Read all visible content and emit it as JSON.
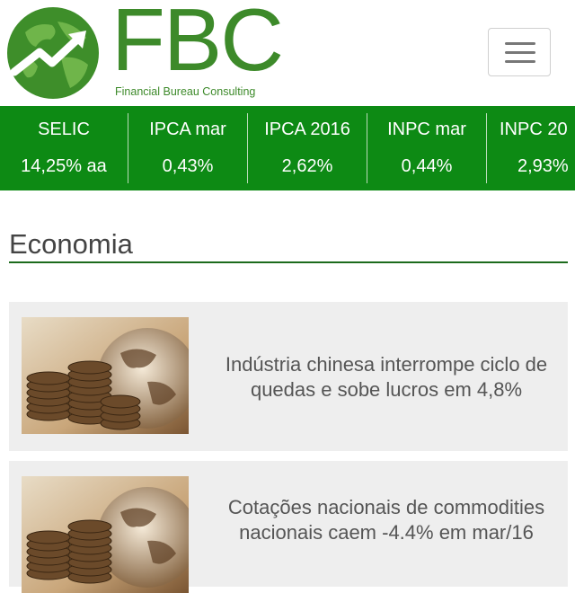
{
  "brand": {
    "name": "FBC",
    "tagline": "Financial Bureau Consulting",
    "color": "#3d8a2a"
  },
  "header": {
    "menu_icon": "hamburger-menu-icon"
  },
  "ticker": {
    "background": "#0d8a14",
    "items": [
      {
        "label": "SELIC",
        "value": "14,25% aa"
      },
      {
        "label": "IPCA mar",
        "value": "0,43%"
      },
      {
        "label": "IPCA 2016",
        "value": "2,62%"
      },
      {
        "label": "INPC mar",
        "value": "0,44%"
      },
      {
        "label": "INPC 20",
        "value": "2,93%"
      }
    ]
  },
  "section": {
    "title": "Economia"
  },
  "articles": [
    {
      "title": "Indústria chinesa interrompe ciclo de quedas e sobe lucros em 4,8%",
      "thumb_icon": "coins-globe-image"
    },
    {
      "title": "Cotações nacionais de commodities nacionais caem -4.4% em mar/16",
      "thumb_icon": "coins-globe-image"
    }
  ]
}
